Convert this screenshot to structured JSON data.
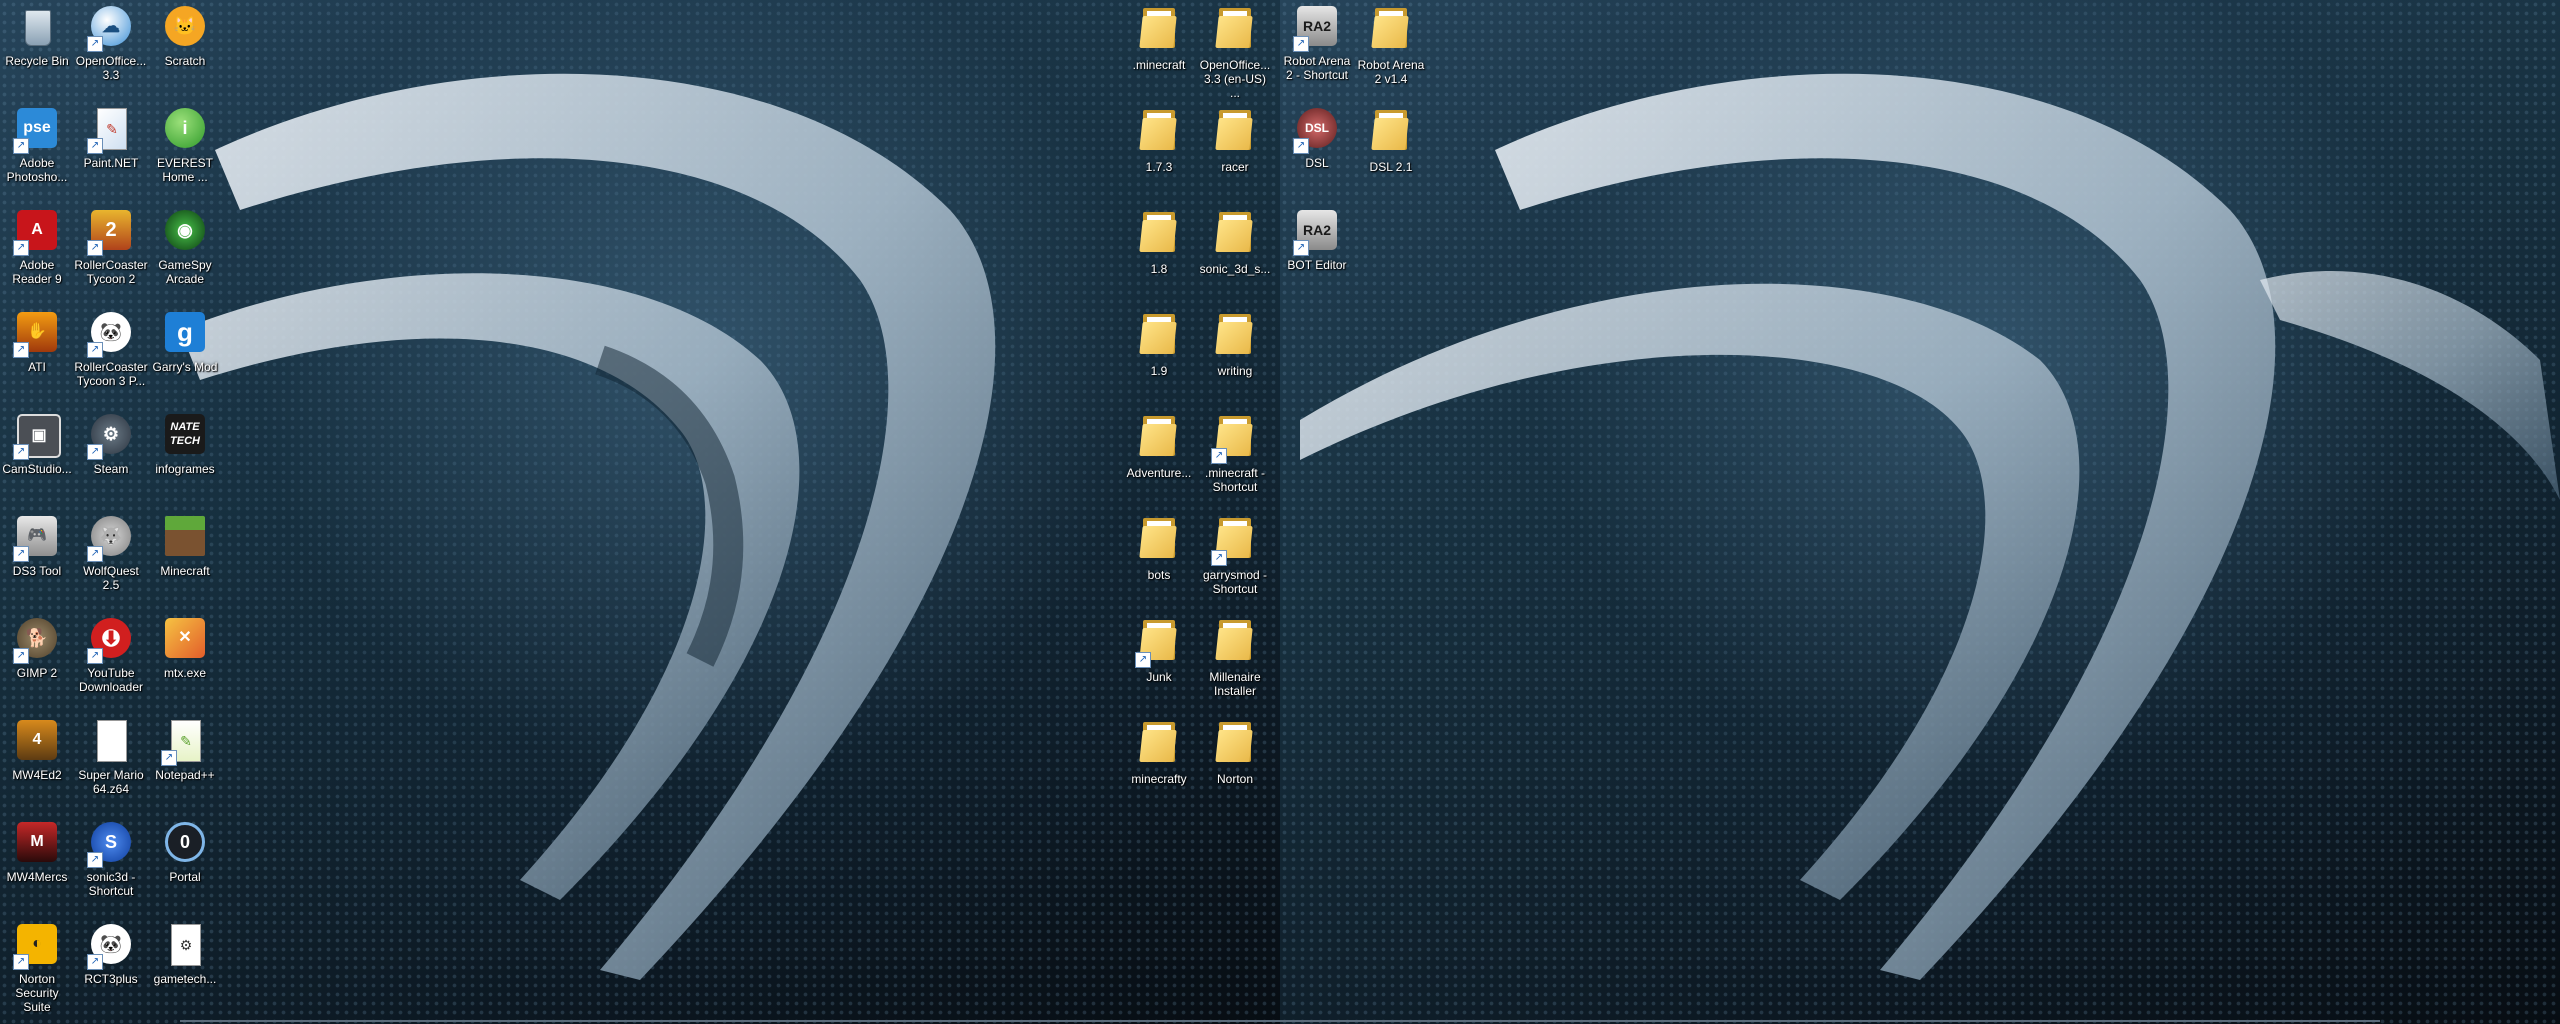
{
  "desktop": {
    "left_icons": [
      {
        "label": "Recycle Bin",
        "icon": "recycle-bin-icon"
      },
      {
        "label": "OpenOffice... 3.3",
        "icon": "openoffice-icon"
      },
      {
        "label": "Scratch",
        "icon": "scratch-icon"
      },
      {
        "label": "Adobe Photosho...",
        "icon": "photoshop-icon"
      },
      {
        "label": "Paint.NET",
        "icon": "paintnet-icon"
      },
      {
        "label": "EVEREST Home ...",
        "icon": "everest-icon"
      },
      {
        "label": "Adobe Reader 9",
        "icon": "adobe-reader-icon"
      },
      {
        "label": "RollerCoaster Tycoon 2",
        "icon": "rollercoaster-tycoon-icon"
      },
      {
        "label": "GameSpy Arcade",
        "icon": "gamespy-icon"
      },
      {
        "label": "ATI",
        "icon": "ati-icon"
      },
      {
        "label": "RollerCoaster Tycoon 3 P...",
        "icon": "rct3-icon"
      },
      {
        "label": "Garry's Mod",
        "icon": "garrys-mod-icon"
      },
      {
        "label": "CamStudio...",
        "icon": "camstudio-icon"
      },
      {
        "label": "Steam",
        "icon": "steam-icon"
      },
      {
        "label": "infogrames",
        "icon": "infogrames-icon"
      },
      {
        "label": "DS3 Tool",
        "icon": "gamepad-icon"
      },
      {
        "label": "WolfQuest 2.5",
        "icon": "wolfquest-icon"
      },
      {
        "label": "Minecraft",
        "icon": "minecraft-icon"
      },
      {
        "label": "GIMP 2",
        "icon": "gimp-icon"
      },
      {
        "label": "YouTube Downloader",
        "icon": "youtube-downloader-icon"
      },
      {
        "label": "mtx.exe",
        "icon": "mtx-icon"
      },
      {
        "label": "MW4Ed2",
        "icon": "mw4ed2-icon"
      },
      {
        "label": "Super Mario 64.z64",
        "icon": "blank-file-icon"
      },
      {
        "label": "Notepad++",
        "icon": "notepadpp-icon"
      },
      {
        "label": "MW4Mercs",
        "icon": "mw4mercs-icon"
      },
      {
        "label": "sonic3d - Shortcut",
        "icon": "sonic-icon"
      },
      {
        "label": "Portal",
        "icon": "portal-icon"
      },
      {
        "label": "Norton Security Suite",
        "icon": "norton-icon"
      },
      {
        "label": "RCT3plus",
        "icon": "rct3plus-icon"
      },
      {
        "label": "gametech...",
        "icon": "document-icon"
      }
    ],
    "folder_icons": [
      {
        "label": ".minecraft"
      },
      {
        "label": "OpenOffice... 3.3 (en-US) ..."
      },
      {
        "label": "1.7.3"
      },
      {
        "label": "racer"
      },
      {
        "label": "1.8"
      },
      {
        "label": "sonic_3d_s..."
      },
      {
        "label": "1.9"
      },
      {
        "label": "writing"
      },
      {
        "label": "Adventure..."
      },
      {
        "label": ".minecraft - Shortcut"
      },
      {
        "label": "bots"
      },
      {
        "label": "garrysmod - Shortcut"
      },
      {
        "label": "Junk"
      },
      {
        "label": "Millenaire Installer"
      },
      {
        "label": "minecrafty"
      },
      {
        "label": "Norton"
      }
    ],
    "second_monitor_icons": [
      {
        "label": "Robot Arena 2 - Shortcut",
        "icon": "robot-arena-icon"
      },
      {
        "label": "Robot Arena 2 v1.4",
        "icon": "folder-icon"
      },
      {
        "label": "DSL",
        "icon": "dsl-icon"
      },
      {
        "label": "DSL 2.1",
        "icon": "folder-icon"
      },
      {
        "label": "BOT Editor",
        "icon": "robot-arena-icon"
      }
    ],
    "wallpaper_color": "#17303f"
  }
}
